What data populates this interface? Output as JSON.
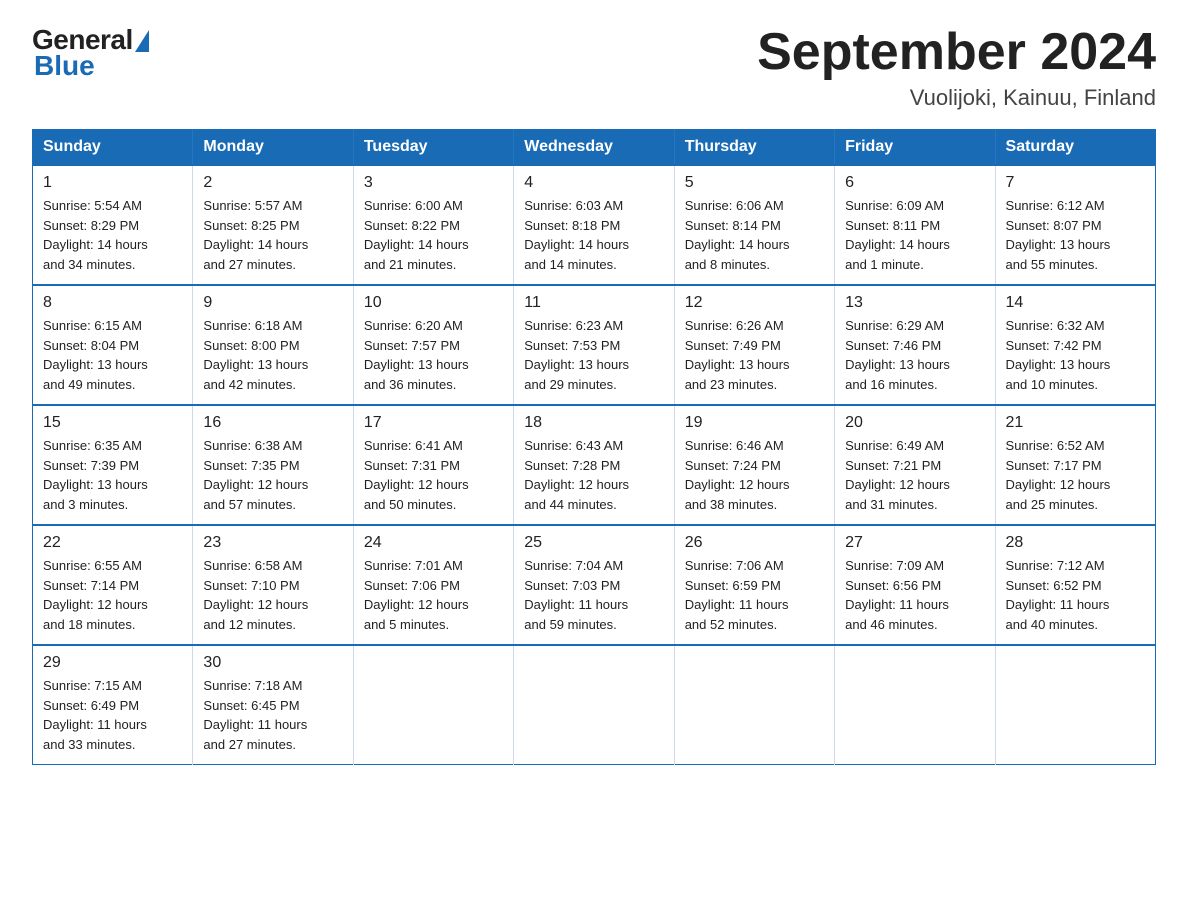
{
  "logo": {
    "general": "General",
    "blue": "Blue"
  },
  "title": "September 2024",
  "location": "Vuolijoki, Kainuu, Finland",
  "weekdays": [
    "Sunday",
    "Monday",
    "Tuesday",
    "Wednesday",
    "Thursday",
    "Friday",
    "Saturday"
  ],
  "weeks": [
    [
      {
        "day": "1",
        "info": "Sunrise: 5:54 AM\nSunset: 8:29 PM\nDaylight: 14 hours\nand 34 minutes."
      },
      {
        "day": "2",
        "info": "Sunrise: 5:57 AM\nSunset: 8:25 PM\nDaylight: 14 hours\nand 27 minutes."
      },
      {
        "day": "3",
        "info": "Sunrise: 6:00 AM\nSunset: 8:22 PM\nDaylight: 14 hours\nand 21 minutes."
      },
      {
        "day": "4",
        "info": "Sunrise: 6:03 AM\nSunset: 8:18 PM\nDaylight: 14 hours\nand 14 minutes."
      },
      {
        "day": "5",
        "info": "Sunrise: 6:06 AM\nSunset: 8:14 PM\nDaylight: 14 hours\nand 8 minutes."
      },
      {
        "day": "6",
        "info": "Sunrise: 6:09 AM\nSunset: 8:11 PM\nDaylight: 14 hours\nand 1 minute."
      },
      {
        "day": "7",
        "info": "Sunrise: 6:12 AM\nSunset: 8:07 PM\nDaylight: 13 hours\nand 55 minutes."
      }
    ],
    [
      {
        "day": "8",
        "info": "Sunrise: 6:15 AM\nSunset: 8:04 PM\nDaylight: 13 hours\nand 49 minutes."
      },
      {
        "day": "9",
        "info": "Sunrise: 6:18 AM\nSunset: 8:00 PM\nDaylight: 13 hours\nand 42 minutes."
      },
      {
        "day": "10",
        "info": "Sunrise: 6:20 AM\nSunset: 7:57 PM\nDaylight: 13 hours\nand 36 minutes."
      },
      {
        "day": "11",
        "info": "Sunrise: 6:23 AM\nSunset: 7:53 PM\nDaylight: 13 hours\nand 29 minutes."
      },
      {
        "day": "12",
        "info": "Sunrise: 6:26 AM\nSunset: 7:49 PM\nDaylight: 13 hours\nand 23 minutes."
      },
      {
        "day": "13",
        "info": "Sunrise: 6:29 AM\nSunset: 7:46 PM\nDaylight: 13 hours\nand 16 minutes."
      },
      {
        "day": "14",
        "info": "Sunrise: 6:32 AM\nSunset: 7:42 PM\nDaylight: 13 hours\nand 10 minutes."
      }
    ],
    [
      {
        "day": "15",
        "info": "Sunrise: 6:35 AM\nSunset: 7:39 PM\nDaylight: 13 hours\nand 3 minutes."
      },
      {
        "day": "16",
        "info": "Sunrise: 6:38 AM\nSunset: 7:35 PM\nDaylight: 12 hours\nand 57 minutes."
      },
      {
        "day": "17",
        "info": "Sunrise: 6:41 AM\nSunset: 7:31 PM\nDaylight: 12 hours\nand 50 minutes."
      },
      {
        "day": "18",
        "info": "Sunrise: 6:43 AM\nSunset: 7:28 PM\nDaylight: 12 hours\nand 44 minutes."
      },
      {
        "day": "19",
        "info": "Sunrise: 6:46 AM\nSunset: 7:24 PM\nDaylight: 12 hours\nand 38 minutes."
      },
      {
        "day": "20",
        "info": "Sunrise: 6:49 AM\nSunset: 7:21 PM\nDaylight: 12 hours\nand 31 minutes."
      },
      {
        "day": "21",
        "info": "Sunrise: 6:52 AM\nSunset: 7:17 PM\nDaylight: 12 hours\nand 25 minutes."
      }
    ],
    [
      {
        "day": "22",
        "info": "Sunrise: 6:55 AM\nSunset: 7:14 PM\nDaylight: 12 hours\nand 18 minutes."
      },
      {
        "day": "23",
        "info": "Sunrise: 6:58 AM\nSunset: 7:10 PM\nDaylight: 12 hours\nand 12 minutes."
      },
      {
        "day": "24",
        "info": "Sunrise: 7:01 AM\nSunset: 7:06 PM\nDaylight: 12 hours\nand 5 minutes."
      },
      {
        "day": "25",
        "info": "Sunrise: 7:04 AM\nSunset: 7:03 PM\nDaylight: 11 hours\nand 59 minutes."
      },
      {
        "day": "26",
        "info": "Sunrise: 7:06 AM\nSunset: 6:59 PM\nDaylight: 11 hours\nand 52 minutes."
      },
      {
        "day": "27",
        "info": "Sunrise: 7:09 AM\nSunset: 6:56 PM\nDaylight: 11 hours\nand 46 minutes."
      },
      {
        "day": "28",
        "info": "Sunrise: 7:12 AM\nSunset: 6:52 PM\nDaylight: 11 hours\nand 40 minutes."
      }
    ],
    [
      {
        "day": "29",
        "info": "Sunrise: 7:15 AM\nSunset: 6:49 PM\nDaylight: 11 hours\nand 33 minutes."
      },
      {
        "day": "30",
        "info": "Sunrise: 7:18 AM\nSunset: 6:45 PM\nDaylight: 11 hours\nand 27 minutes."
      },
      {
        "day": "",
        "info": ""
      },
      {
        "day": "",
        "info": ""
      },
      {
        "day": "",
        "info": ""
      },
      {
        "day": "",
        "info": ""
      },
      {
        "day": "",
        "info": ""
      }
    ]
  ]
}
